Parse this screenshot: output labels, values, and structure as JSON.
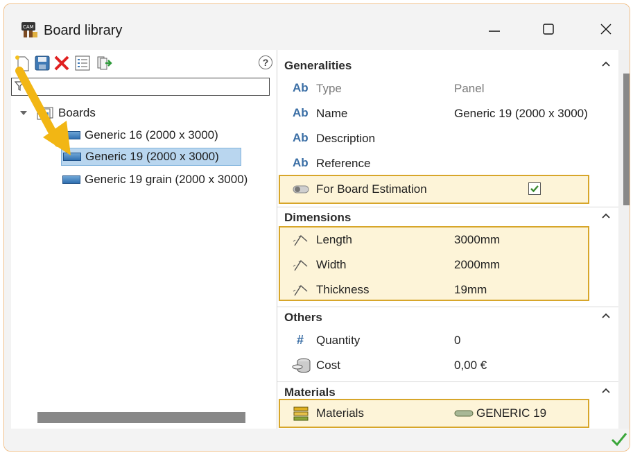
{
  "window": {
    "title": "Board library"
  },
  "tree": {
    "root_label": "Boards",
    "items": [
      {
        "label": "Generic 16 (2000 x 3000)"
      },
      {
        "label": "Generic 19 (2000 x 3000)"
      },
      {
        "label": "Generic 19 grain (2000 x 3000)"
      }
    ]
  },
  "help": {
    "label": "?"
  },
  "sections": {
    "generalities": {
      "title": "Generalities",
      "rows": {
        "type": {
          "prefix": "Ab",
          "name": "Type",
          "value": "Panel"
        },
        "name": {
          "prefix": "Ab",
          "name": "Name",
          "value": "Generic 19 (2000 x 3000)"
        },
        "description": {
          "prefix": "Ab",
          "name": "Description",
          "value": ""
        },
        "reference": {
          "prefix": "Ab",
          "name": "Reference",
          "value": ""
        },
        "estimation": {
          "name": "For Board Estimation",
          "checked": true
        }
      }
    },
    "dimensions": {
      "title": "Dimensions",
      "rows": {
        "length": {
          "name": "Length",
          "value": "3000mm"
        },
        "width": {
          "name": "Width",
          "value": "2000mm"
        },
        "thickness": {
          "name": "Thickness",
          "value": "19mm"
        }
      }
    },
    "others": {
      "title": "Others",
      "rows": {
        "quantity": {
          "prefix": "#",
          "name": "Quantity",
          "value": "0"
        },
        "cost": {
          "name": "Cost",
          "value": "0,00 €"
        }
      }
    },
    "materials": {
      "title": "Materials",
      "rows": {
        "materials": {
          "name": "Materials",
          "value": "GENERIC 19"
        }
      }
    }
  },
  "colors": {
    "highlight_border": "#d7a62a",
    "highlight_fill": "#fdf4d8",
    "selection": "#b9d6ef",
    "arrow": "#f2b614",
    "ok_check": "#3aa63a"
  }
}
